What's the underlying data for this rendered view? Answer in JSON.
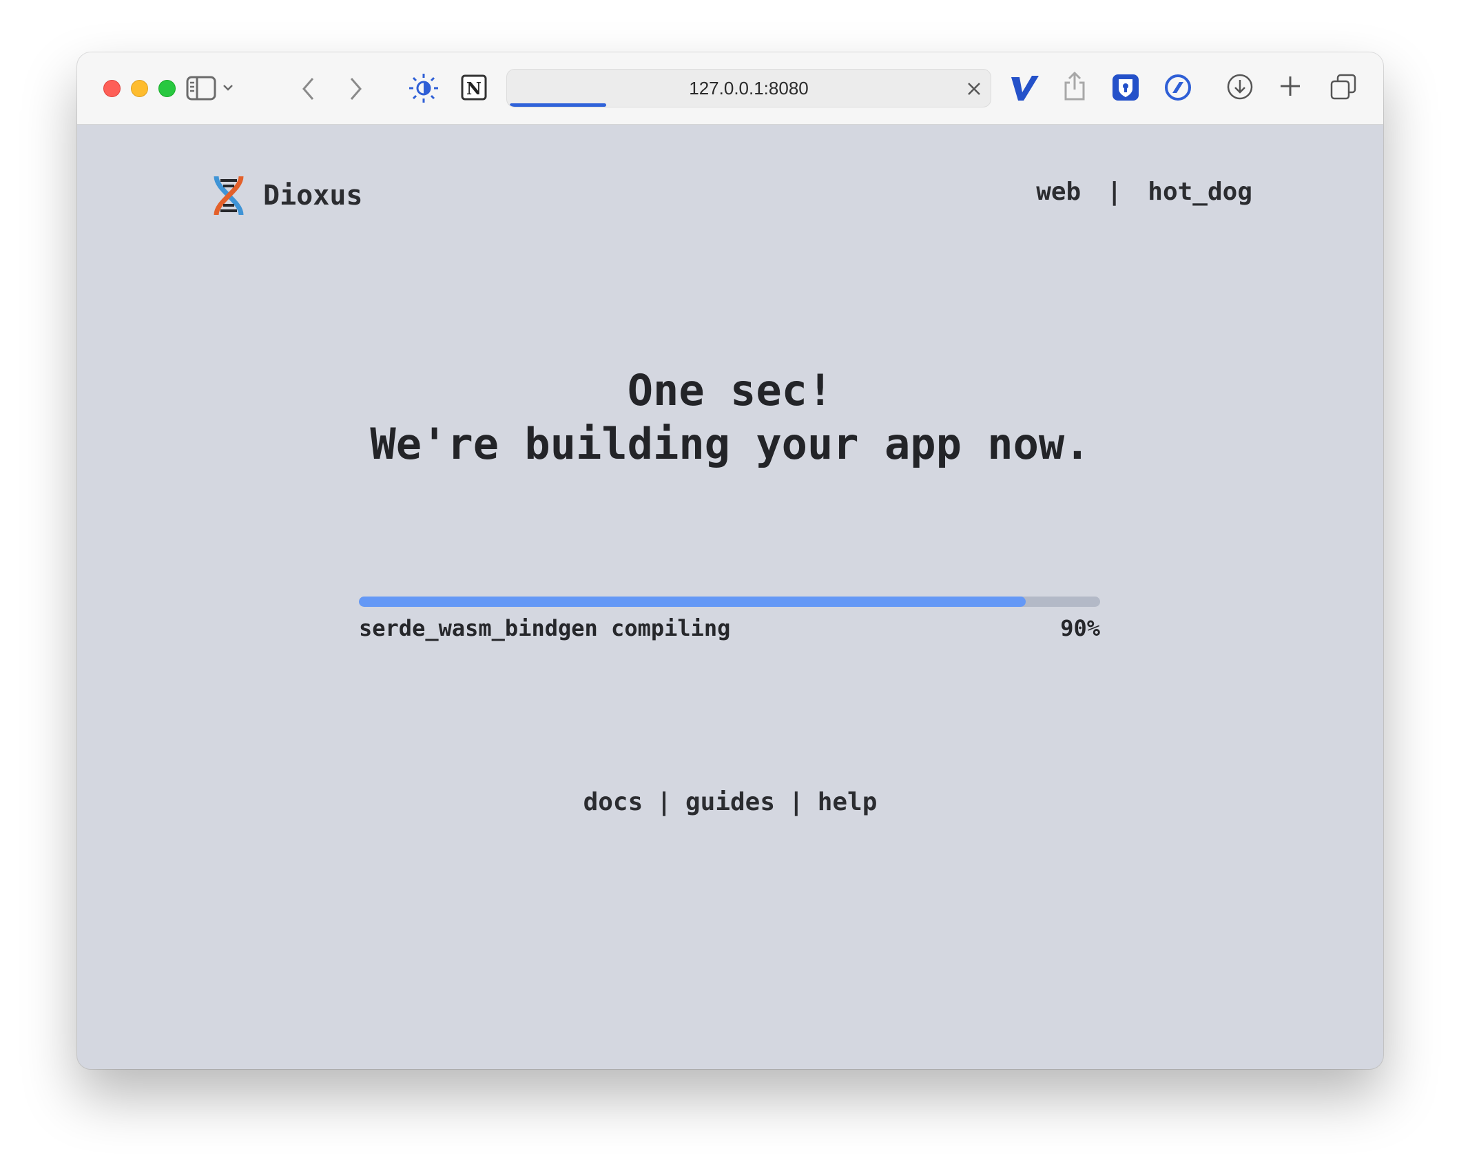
{
  "browser": {
    "url": "127.0.0.1:8080",
    "icons": [
      "sidebar-icon",
      "chevron-down-icon",
      "back-icon",
      "forward-icon",
      "brightness-icon",
      "notion-icon",
      "close-icon",
      "vimlike-icon",
      "share-icon",
      "bitwarden-icon",
      "blocker-icon",
      "download-icon",
      "new-tab-icon",
      "tabs-overview-icon"
    ],
    "page_load_progress": 0.2
  },
  "header": {
    "brand": "Dioxus",
    "platform": "web",
    "separator": "|",
    "app_name": "hot_dog"
  },
  "main": {
    "headline_line1": "One sec!",
    "headline_line2": "We're building your app now.",
    "progress": {
      "status_text": "serde_wasm_bindgen compiling",
      "percent_label": "90%",
      "value": 0.9
    }
  },
  "footer": {
    "links": [
      "docs",
      "guides",
      "help"
    ],
    "separator": "|"
  },
  "colors": {
    "page_background": "#d4d7e0",
    "progress_fill": "#6498f6",
    "progress_track": "#b3b9c7",
    "text": "#26272b",
    "logo_orange": "#e3602a",
    "logo_blue": "#3f94d6"
  }
}
